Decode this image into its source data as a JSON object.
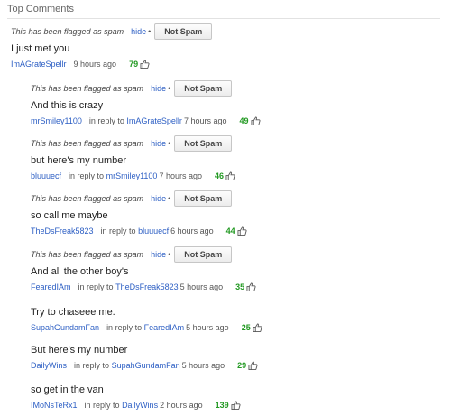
{
  "section": {
    "title": "Top Comments"
  },
  "labels": {
    "flagged": "This has been flagged as spam",
    "hide": "hide",
    "not_spam": "Not Spam",
    "in_reply_to": "in reply to"
  },
  "comments": [
    {
      "text": "I just met you",
      "author": "ImAGrateSpellr",
      "age": "9 hours ago",
      "likes": "79"
    },
    {
      "text": "And this is crazy",
      "author": "mrSmiley1100",
      "reply_to": "ImAGrateSpellr",
      "age": "7 hours ago",
      "likes": "49"
    },
    {
      "text": "but here's my number",
      "author": "bluuuecf",
      "reply_to": "mrSmiley1100",
      "age": "7 hours ago",
      "likes": "46"
    },
    {
      "text": "so call me maybe",
      "author": "TheDsFreak5823",
      "reply_to": "bluuuecf",
      "age": "6 hours ago",
      "likes": "44"
    },
    {
      "text": "And all the other boy's",
      "author": "FearedIAm",
      "reply_to": "TheDsFreak5823",
      "age": "5 hours ago",
      "likes": "35"
    },
    {
      "text": "Try to chaseee me.",
      "author": "SupahGundamFan",
      "reply_to": "FearedIAm",
      "age": "5 hours ago",
      "likes": "25"
    },
    {
      "text": "But here's my number",
      "author": "DailyWins",
      "reply_to": "SupahGundamFan",
      "age": "5 hours ago",
      "likes": "29"
    },
    {
      "text": "so get in the van",
      "author": "IMoNsTeRx1",
      "reply_to": "DailyWins",
      "age": "2 hours ago",
      "likes": "139"
    }
  ],
  "icons": {
    "like": "thumbs-up-icon"
  },
  "colors": {
    "link": "#2d5fc4",
    "likes": "#229922"
  }
}
